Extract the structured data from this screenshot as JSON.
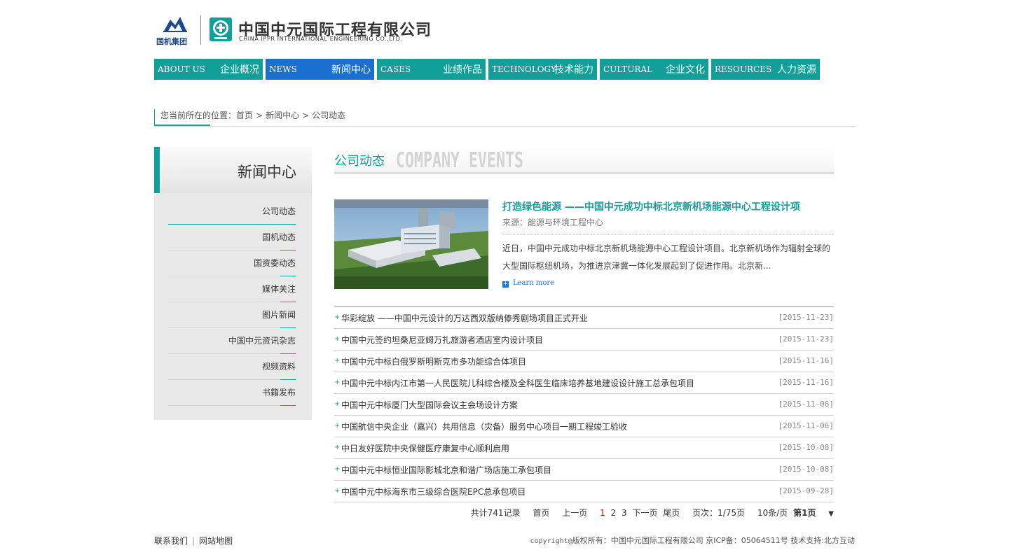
{
  "header": {
    "group_logo_text": "国机集团",
    "company_cn": "中国中元国际工程有限公司",
    "company_en": "CHINA IPPR INTERNATIONAL ENGINEERING CO.,LTD."
  },
  "nav": [
    {
      "en": "ABOUT US",
      "cn": "企业概况"
    },
    {
      "en": "NEWS",
      "cn": "新闻中心"
    },
    {
      "en": "CASES",
      "cn": "业绩作品"
    },
    {
      "en": "TECHNOLOGY",
      "cn": "技术能力"
    },
    {
      "en": "CULTURAL",
      "cn": "企业文化"
    },
    {
      "en": "RESOURCES",
      "cn": "人力资源"
    }
  ],
  "breadcrumb": {
    "prefix": "您当前所在的位置：",
    "items": [
      "首页",
      "新闻中心",
      "公司动态"
    ],
    "separator": ">"
  },
  "sidebar": {
    "title": "新闻中心",
    "items": [
      "公司动态",
      "国机动态",
      "国资委动态",
      "媒体关注",
      "图片新闻",
      "中国中元资讯杂志",
      "视频资料",
      "书籍发布"
    ]
  },
  "section": {
    "title_cn": "公司动态",
    "title_en": "COMPANY EVENTS"
  },
  "feature": {
    "title": "打造绿色能源 ——中国中元成功中标北京新机场能源中心工程设计项",
    "source": "来源：能源与环境工程中心",
    "desc": "近日，中国中元成功中标北京新机场能源中心工程设计项目。北京新机场作为辐射全球的大型国际枢纽机场，为推进京津冀一体化发展起到了促进作用。北京新...",
    "more": "Learn more"
  },
  "news": [
    {
      "title": "华彩绽放 ——中国中元设计的万达西双版纳傣秀剧场项目正式开业",
      "date": "[2015-11-23]"
    },
    {
      "title": "中国中元签约坦桑尼亚姆万扎旅游者酒店室内设计项目",
      "date": "[2015-11-23]"
    },
    {
      "title": "中国中元中标白俄罗斯明斯克市多功能综合体项目",
      "date": "[2015-11-16]"
    },
    {
      "title": "中国中元中标内江市第一人民医院儿科综合楼及全科医生临床培养基地建设设计施工总承包项目",
      "date": "[2015-11-16]"
    },
    {
      "title": "中国中元中标厦门大型国际会议主会场设计方案",
      "date": "[2015-11-06]"
    },
    {
      "title": "中国航信中央企业（嘉兴）共用信息（灾备）服务中心项目一期工程竣工验收",
      "date": "[2015-11-06]"
    },
    {
      "title": "中日友好医院中央保健医疗康复中心顺利启用",
      "date": "[2015-10-08]"
    },
    {
      "title": "中国中元中标恒业国际影城北京和谐广场店施工承包项目",
      "date": "[2015-10-08]"
    },
    {
      "title": "中国中元中标海东市三级综合医院EPC总承包项目",
      "date": "[2015-09-28]"
    }
  ],
  "pager": {
    "total": "共计741记录",
    "first": "首页",
    "prev": "上一页",
    "pages": [
      "1",
      "2",
      "3"
    ],
    "next": "下一页",
    "last": "尾页",
    "page_info": "页次：1/75页",
    "per_page": "10条/页",
    "current": "第1页",
    "dropdown_arrow": "▼"
  },
  "footer": {
    "contact": "联系我们",
    "sitemap": "网站地图",
    "copyright_prefix": "copyright@",
    "copyright": "版权所有：中国中元国际工程有限公司",
    "icp": "京ICP备：05064511号",
    "support": "技术支持:北方互动"
  },
  "colors": {
    "teal": "#129e99",
    "nav_active": "#1b6fd1"
  }
}
